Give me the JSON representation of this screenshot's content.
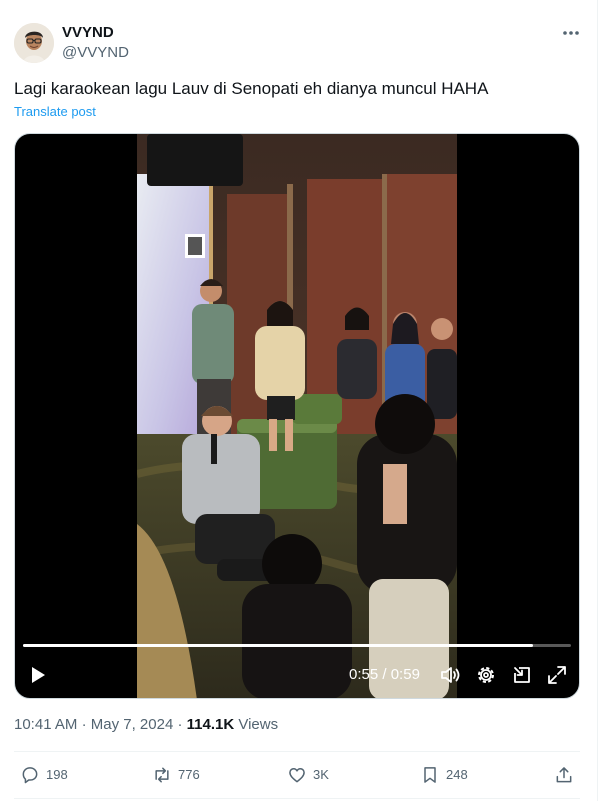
{
  "author": {
    "display_name": "VVYND",
    "handle": "@VVYND",
    "avatar_icon": "person-avatar"
  },
  "post": {
    "text": "Lagi karaokean lagu Lauv di Senopati eh dianya muncul HAHA",
    "translate_label": "Translate post"
  },
  "video": {
    "current_time": "0:55",
    "separator": "/",
    "duration": "0:59",
    "progress": 0.93,
    "icons": [
      "play-icon",
      "volume-icon",
      "settings-icon",
      "minimize-icon",
      "fullscreen-icon"
    ]
  },
  "meta": {
    "time": "10:41 AM",
    "dot1": "·",
    "date": "May 7, 2024",
    "dot2": "·",
    "views_count": "114.1K",
    "views_label": "Views"
  },
  "actions": {
    "reply_count": "198",
    "repost_count": "776",
    "like_count": "3K",
    "bookmark_count": "248"
  },
  "colors": {
    "text_primary": "#0f1419",
    "text_secondary": "#536471",
    "accent": "#1d9bf0",
    "border": "#eff3f4"
  }
}
